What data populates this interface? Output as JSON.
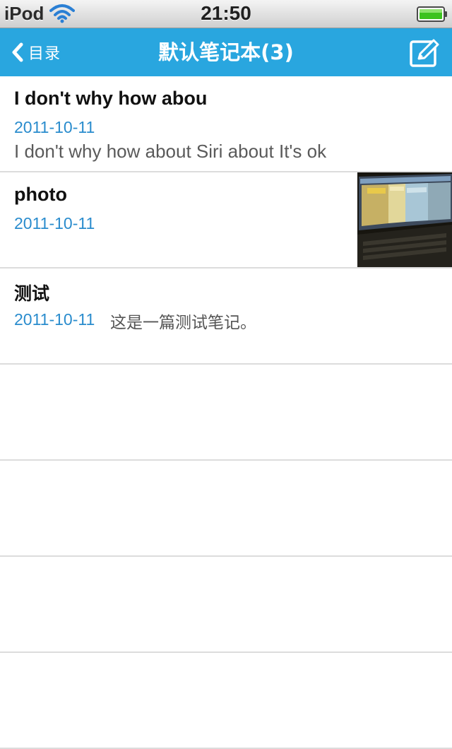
{
  "status_bar": {
    "carrier": "iPod",
    "time": "21:50",
    "wifi_icon": "wifi-icon",
    "battery_icon": "battery-full-icon",
    "battery_color": "#3cc21f"
  },
  "nav": {
    "back_label": "目录",
    "back_icon": "chevron-left-icon",
    "title": "默认笔记本(3)",
    "compose_icon": "compose-icon",
    "bar_color": "#29a6df"
  },
  "notes": [
    {
      "title": "I don't why how abou",
      "date": "2011-10-11",
      "snippet": "I don't why how about Siri about It's ok",
      "has_thumbnail": false
    },
    {
      "title": "photo",
      "date": "2011-10-11",
      "snippet": "",
      "has_thumbnail": true,
      "thumbnail_icon": "photo-thumbnail"
    },
    {
      "title": "测试",
      "date": "2011-10-11",
      "snippet": "这是一篇测试笔记。",
      "has_thumbnail": false
    }
  ],
  "colors": {
    "date_text": "#2a8ccd",
    "title_text": "#111111",
    "snippet_text": "#5a5a5a",
    "separator": "#dcdcdc"
  }
}
